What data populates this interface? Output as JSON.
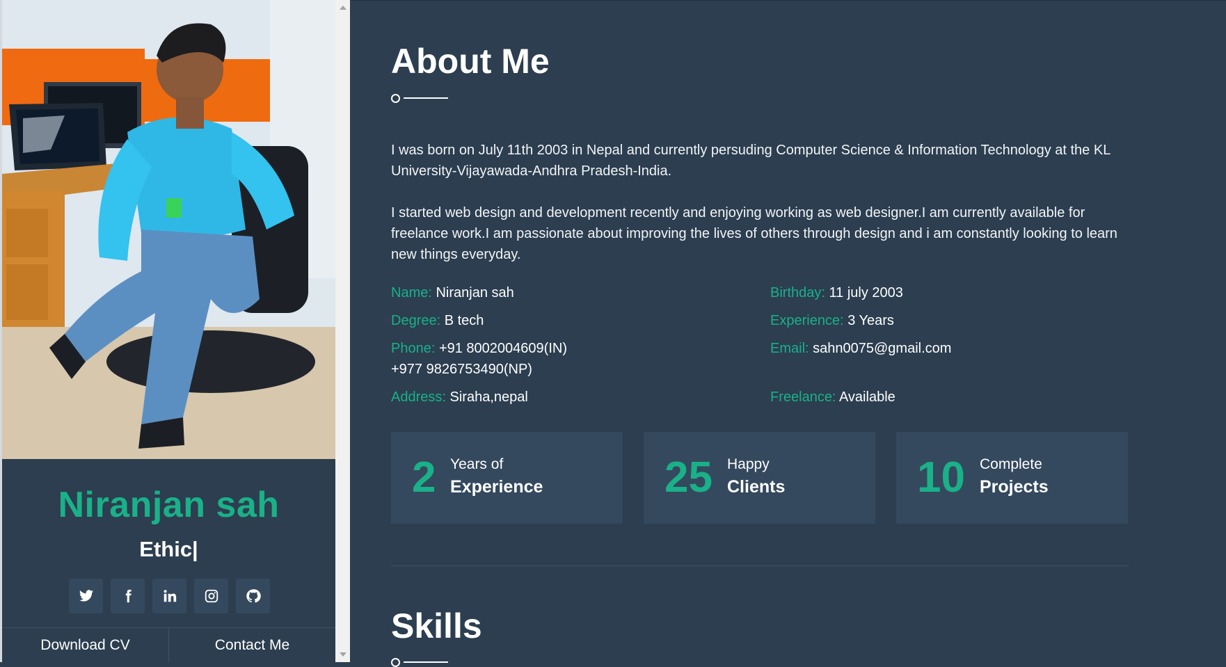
{
  "profile": {
    "name": "Niranjan sah",
    "typed_role": "Ethic|",
    "photo_icon": "profile-photo",
    "socials": [
      {
        "icon": "twitter-icon"
      },
      {
        "icon": "facebook-icon"
      },
      {
        "icon": "linkedin-icon"
      },
      {
        "icon": "instagram-icon"
      },
      {
        "icon": "github-icon"
      }
    ],
    "download_cv_label": "Download CV",
    "contact_label": "Contact Me"
  },
  "about": {
    "title": "About Me",
    "paragraph1": "I was born on July 11th 2003 in Nepal and currently persuding Computer Science & Information Technology at the KL University-Vijayawada-Andhra Pradesh-India.",
    "paragraph2": "I started web design and development recently and enjoying working as web designer.I am currently available for freelance work.I am passionate about improving the lives of others through design and i am constantly looking to learn new things everyday.",
    "info": {
      "name_key": "Name:",
      "name_val": "Niranjan sah",
      "birthday_key": "Birthday:",
      "birthday_val": "11 july 2003",
      "degree_key": "Degree:",
      "degree_val": "B tech",
      "experience_key": "Experience:",
      "experience_val": "3 Years",
      "phone_key": "Phone:",
      "phone_val1": "+91 8002004609(IN)",
      "phone_val2": "+977 9826753490(NP)",
      "email_key": "Email:",
      "email_val": "sahn0075@gmail.com",
      "address_key": "Address:",
      "address_val": "Siraha,nepal",
      "freelance_key": "Freelance:",
      "freelance_val": "Available"
    },
    "stats": [
      {
        "number": "2",
        "sub": "Years of",
        "main": "Experience"
      },
      {
        "number": "25",
        "sub": "Happy",
        "main": "Clients"
      },
      {
        "number": "10",
        "sub": "Complete",
        "main": "Projects"
      }
    ]
  },
  "skills": {
    "title": "Skills"
  },
  "colors": {
    "accent": "#1ab188",
    "background": "#2c3e50",
    "card": "#34495e"
  }
}
